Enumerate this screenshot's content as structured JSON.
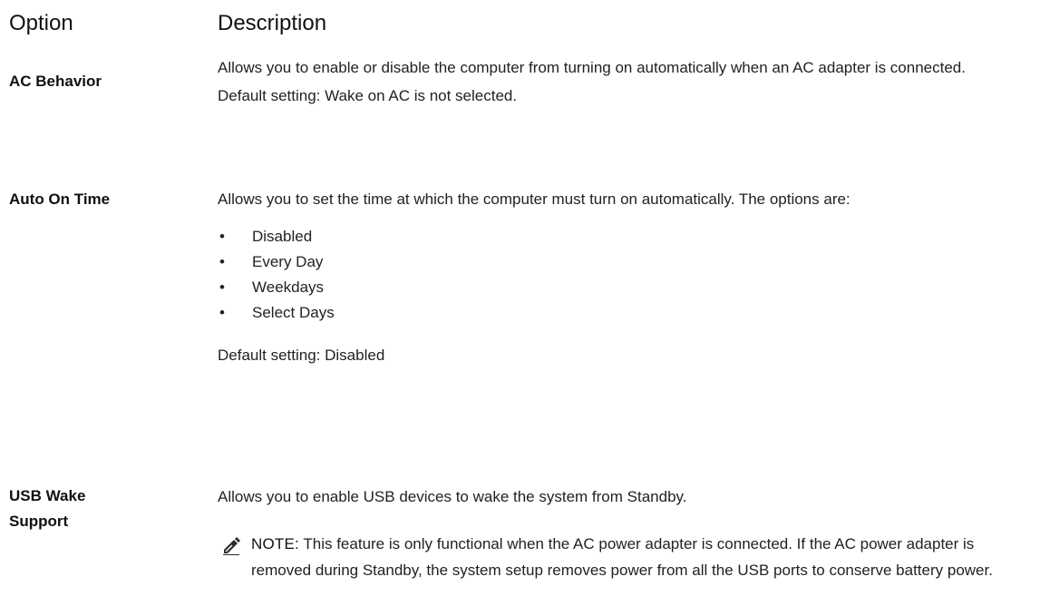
{
  "header": {
    "option": "Option",
    "description": "Description"
  },
  "rows": [
    {
      "option": "AC Behavior",
      "description": "Allows you to enable or disable the computer from turning on automatically when an AC adapter is connected.",
      "default": "Default setting: Wake on AC is not selected."
    },
    {
      "option": "Auto On Time",
      "description": "Allows you to set the time at which the computer must turn on automatically. The options are:",
      "bullets": [
        "Disabled",
        "Every Day",
        "Weekdays",
        "Select Days"
      ],
      "default": "Default setting: Disabled"
    },
    {
      "option_line1": "USB Wake",
      "option_line2": "Support",
      "description": "Allows you to enable USB devices to wake the system from Standby.",
      "note_label": "NOTE:",
      "note_text": " This feature is only functional when the AC power adapter is connected. If the AC power adapter is removed during Standby, the system setup removes power from all the USB ports to conserve battery power."
    }
  ],
  "icons": {
    "bullet": "•",
    "note_icon": "pencil-note-icon"
  }
}
